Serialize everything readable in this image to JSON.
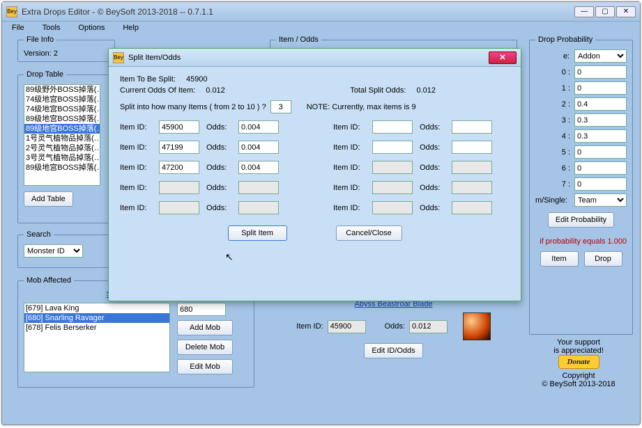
{
  "window": {
    "title": "Extra Drops Editor - © BeySoft  2013-2018  --  0.7.1.1",
    "icon_txt": "Bey"
  },
  "menu": {
    "file": "File",
    "tools": "Tools",
    "options": "Options",
    "help": "Help"
  },
  "fileinfo": {
    "legend": "File Info",
    "version_lbl": "Version:",
    "version": "2"
  },
  "itemodds": {
    "legend": "Item / Odds"
  },
  "droptable": {
    "legend": "Drop Table",
    "items": [
      "89级野外BOSS掉落(…",
      "74级地宫BOSS掉落(…",
      "74级地宫BOSS掉落(…",
      "89级地宫BOSS掉落(…",
      "89级地宫BOSS掉落(…",
      "1号灵气植物品掉落(…",
      "2号灵气植物品掉落(…",
      "3号灵气植物品掉落(…",
      "",
      "89级地宫BOSS掉落(…"
    ],
    "sel_idx": 4,
    "add": "Add Table"
  },
  "search": {
    "legend": "Search",
    "dropdown": "Monster ID"
  },
  "mob": {
    "legend": "Mob Affected",
    "link": "Snarling Ravager",
    "items": [
      "[679] Lava King",
      "[680] Snarling Ravager",
      "[678] Felis Berserker"
    ],
    "sel_idx": 1,
    "id_val": "680",
    "add": "Add Mob",
    "del": "Delete Mob",
    "edit": "Edit Mob"
  },
  "prob": {
    "legend": "Drop Probability",
    "type_sel": "Addon",
    "rows": [
      {
        "lbl": "0 :",
        "val": "0"
      },
      {
        "lbl": "1 :",
        "val": "0"
      },
      {
        "lbl": "2 :",
        "val": "0.4"
      },
      {
        "lbl": "3 :",
        "val": "0.3"
      },
      {
        "lbl": "4 :",
        "val": "0.3"
      },
      {
        "lbl": "5 :",
        "val": "0"
      },
      {
        "lbl": "6 :",
        "val": "0"
      },
      {
        "lbl": "7 :",
        "val": "0"
      }
    ],
    "ts_lbl": "m/Single:",
    "ts_val": "Team",
    "editbtn": "Edit Probability",
    "notice": "if probability equals 1.000",
    "item_btn": "Item",
    "drop_btn": "Drop"
  },
  "bottom_item": {
    "link": "Abyss Beastroar Blade",
    "id_lbl": "Item ID:",
    "id_val": "45900",
    "odds_lbl": "Odds:",
    "odds_val": "0.012",
    "edit": "Edit ID/Odds"
  },
  "support": {
    "l1": "Your support",
    "l2": "is appreciated!",
    "donate": "Donate",
    "c1": "Copyright",
    "c2": "© BeySoft  2013-2018"
  },
  "modal": {
    "title": "Split Item/Odds",
    "tobe_lbl": "Item To Be Split:",
    "tobe_val": "45900",
    "cur_lbl": "Current Odds Of Item:",
    "cur_val": "0.012",
    "tot_lbl": "Total Split Odds:",
    "tot_val": "0.012",
    "count_lbl": "Split into how many Items ( from 2 to 10 ) ?",
    "count_val": "3",
    "note": "NOTE: Currently, max items is 9",
    "id_lbl": "Item ID:",
    "odds_lbl": "Odds:",
    "rows": [
      {
        "id": "45900",
        "odds": "0.004"
      },
      {
        "id": "",
        "odds": ""
      },
      {
        "id": "47199",
        "odds": "0.004"
      },
      {
        "id": "",
        "odds": ""
      },
      {
        "id": "47200",
        "odds": "0.004"
      },
      {
        "id": "",
        "odds": ""
      },
      {
        "id": "",
        "odds": ""
      },
      {
        "id": "",
        "odds": ""
      },
      {
        "id": "",
        "odds": ""
      },
      {
        "id": "",
        "odds": ""
      }
    ],
    "split_btn": "Split Item",
    "cancel_btn": "Cancel/Close"
  }
}
